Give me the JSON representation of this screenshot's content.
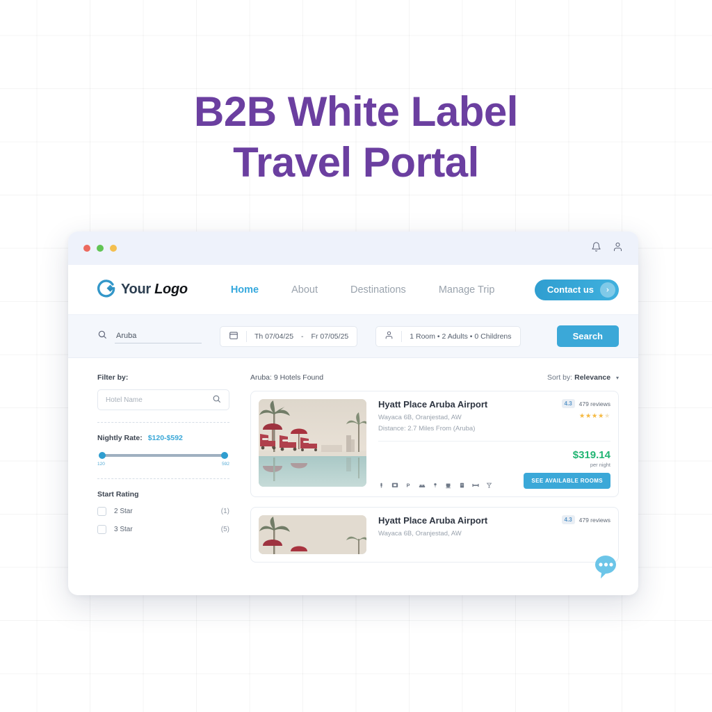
{
  "hero": {
    "line1": "B2B White Label",
    "line2": "Travel Portal",
    "color": "#6b3fa0"
  },
  "window": {
    "titlebar": {
      "dots": [
        "red",
        "green",
        "yellow"
      ],
      "notification_icon": "bell-icon",
      "account_icon": "user-icon"
    },
    "nav": {
      "logo_word1": "Your",
      "logo_word2": "Logo",
      "links": [
        {
          "label": "Home",
          "active": true
        },
        {
          "label": "About",
          "active": false
        },
        {
          "label": "Destinations",
          "active": false
        },
        {
          "label": "Manage Trip",
          "active": false
        }
      ],
      "contact_label": "Contact us",
      "accent": "#3ba8d8"
    },
    "search": {
      "destination_value": "Aruba",
      "destination_placeholder": "Aruba",
      "checkin": "Th 07/04/25",
      "date_separator": "-",
      "checkout": "Fr 07/05/25",
      "occupancy": "1 Room  •  2 Adults  •  0 Childrens",
      "search_label": "Search"
    },
    "sidebar": {
      "filter_title": "Filter by:",
      "hotel_name_placeholder": "Hotel Name",
      "rate_label": "Nightly Rate:",
      "rate_value": "$120-$592",
      "slider_min_label": "120",
      "slider_max_label": "592",
      "star_title": "Start Rating",
      "star_options": [
        {
          "label": "2 Star",
          "count": "(1)",
          "checked": false
        },
        {
          "label": "3 Star",
          "count": "(5)",
          "checked": false
        }
      ]
    },
    "results": {
      "found_text": "Aruba: 9 Hotels Found",
      "sort_prefix": "Sort by:",
      "sort_value": "Relevance",
      "cards": [
        {
          "name": "Hyatt Place Aruba Airport",
          "address": "Wayaca 6B, Oranjestad, AW",
          "distance": "Distance: 2.7 Miles From (Aruba)",
          "score": "4.3",
          "reviews": "479 reviews",
          "stars_filled": 4,
          "stars_total": 5,
          "amenities": [
            "wifi-icon",
            "tv-icon",
            "parking-icon",
            "bed-icon",
            "shower-icon",
            "coffee-icon",
            "fridge-icon",
            "gym-icon",
            "bar-icon"
          ],
          "price": "$319.14",
          "price_note": "per night",
          "cta": "SEE AVAILABLE ROOMS",
          "price_color": "#21b573"
        },
        {
          "name": "Hyatt Place Aruba Airport",
          "address": "Wayaca 6B, Oranjestad, AW",
          "distance": "",
          "score": "4.3",
          "reviews": "479 reviews",
          "stars_filled": 0,
          "stars_total": 0,
          "amenities": [],
          "price": "",
          "price_note": "",
          "cta": "",
          "price_color": "#21b573"
        }
      ]
    },
    "chat": {
      "icon": "chat-bubble-icon",
      "color": "#6cc5e8"
    }
  }
}
